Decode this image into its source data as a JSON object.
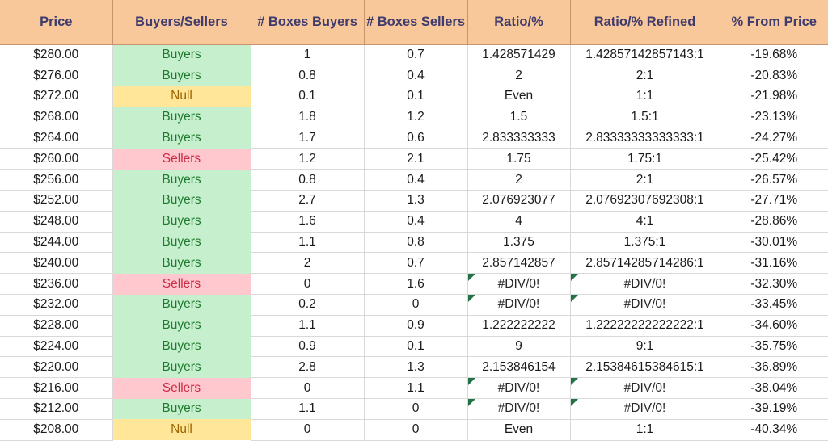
{
  "table": {
    "headers": [
      "Price",
      "Buyers/Sellers",
      "# Boxes Buyers",
      "# Boxes Sellers",
      "Ratio/%",
      "Ratio/% Refined",
      "% From Price"
    ],
    "colors": {
      "header_bg": "#F8C89B",
      "header_text": "#3F3B6D",
      "header_border": "#C8926A",
      "buyers_bg": "#C6EFCE",
      "buyers_text": "#1E7A2E",
      "sellers_bg": "#FFC7CE",
      "sellers_text": "#CC2B43",
      "null_bg": "#FFE699",
      "null_text": "#9C6500",
      "grid_line": "#D9D9D9",
      "error_flag": "#217346"
    },
    "rows": [
      {
        "price": "$280.00",
        "side": "Buyers",
        "side_state": "buyers",
        "boxes_buyers": "1",
        "boxes_sellers": "0.7",
        "ratio": "1.428571429",
        "ratio_error": false,
        "ratio_refined": "1.42857142857143:1",
        "ratio_refined_error": false,
        "pct_from_price": "-19.68%"
      },
      {
        "price": "$276.00",
        "side": "Buyers",
        "side_state": "buyers",
        "boxes_buyers": "0.8",
        "boxes_sellers": "0.4",
        "ratio": "2",
        "ratio_error": false,
        "ratio_refined": "2:1",
        "ratio_refined_error": false,
        "pct_from_price": "-20.83%"
      },
      {
        "price": "$272.00",
        "side": "Null",
        "side_state": "null",
        "boxes_buyers": "0.1",
        "boxes_sellers": "0.1",
        "ratio": "Even",
        "ratio_error": false,
        "ratio_refined": "1:1",
        "ratio_refined_error": false,
        "pct_from_price": "-21.98%"
      },
      {
        "price": "$268.00",
        "side": "Buyers",
        "side_state": "buyers",
        "boxes_buyers": "1.8",
        "boxes_sellers": "1.2",
        "ratio": "1.5",
        "ratio_error": false,
        "ratio_refined": "1.5:1",
        "ratio_refined_error": false,
        "pct_from_price": "-23.13%"
      },
      {
        "price": "$264.00",
        "side": "Buyers",
        "side_state": "buyers",
        "boxes_buyers": "1.7",
        "boxes_sellers": "0.6",
        "ratio": "2.833333333",
        "ratio_error": false,
        "ratio_refined": "2.83333333333333:1",
        "ratio_refined_error": false,
        "pct_from_price": "-24.27%"
      },
      {
        "price": "$260.00",
        "side": "Sellers",
        "side_state": "sellers",
        "boxes_buyers": "1.2",
        "boxes_sellers": "2.1",
        "ratio": "1.75",
        "ratio_error": false,
        "ratio_refined": "1.75:1",
        "ratio_refined_error": false,
        "pct_from_price": "-25.42%"
      },
      {
        "price": "$256.00",
        "side": "Buyers",
        "side_state": "buyers",
        "boxes_buyers": "0.8",
        "boxes_sellers": "0.4",
        "ratio": "2",
        "ratio_error": false,
        "ratio_refined": "2:1",
        "ratio_refined_error": false,
        "pct_from_price": "-26.57%"
      },
      {
        "price": "$252.00",
        "side": "Buyers",
        "side_state": "buyers",
        "boxes_buyers": "2.7",
        "boxes_sellers": "1.3",
        "ratio": "2.076923077",
        "ratio_error": false,
        "ratio_refined": "2.07692307692308:1",
        "ratio_refined_error": false,
        "pct_from_price": "-27.71%"
      },
      {
        "price": "$248.00",
        "side": "Buyers",
        "side_state": "buyers",
        "boxes_buyers": "1.6",
        "boxes_sellers": "0.4",
        "ratio": "4",
        "ratio_error": false,
        "ratio_refined": "4:1",
        "ratio_refined_error": false,
        "pct_from_price": "-28.86%"
      },
      {
        "price": "$244.00",
        "side": "Buyers",
        "side_state": "buyers",
        "boxes_buyers": "1.1",
        "boxes_sellers": "0.8",
        "ratio": "1.375",
        "ratio_error": false,
        "ratio_refined": "1.375:1",
        "ratio_refined_error": false,
        "pct_from_price": "-30.01%"
      },
      {
        "price": "$240.00",
        "side": "Buyers",
        "side_state": "buyers",
        "boxes_buyers": "2",
        "boxes_sellers": "0.7",
        "ratio": "2.857142857",
        "ratio_error": false,
        "ratio_refined": "2.85714285714286:1",
        "ratio_refined_error": false,
        "pct_from_price": "-31.16%"
      },
      {
        "price": "$236.00",
        "side": "Sellers",
        "side_state": "sellers",
        "boxes_buyers": "0",
        "boxes_sellers": "1.6",
        "ratio": "#DIV/0!",
        "ratio_error": true,
        "ratio_refined": "#DIV/0!",
        "ratio_refined_error": true,
        "pct_from_price": "-32.30%"
      },
      {
        "price": "$232.00",
        "side": "Buyers",
        "side_state": "buyers",
        "boxes_buyers": "0.2",
        "boxes_sellers": "0",
        "ratio": "#DIV/0!",
        "ratio_error": true,
        "ratio_refined": "#DIV/0!",
        "ratio_refined_error": true,
        "pct_from_price": "-33.45%"
      },
      {
        "price": "$228.00",
        "side": "Buyers",
        "side_state": "buyers",
        "boxes_buyers": "1.1",
        "boxes_sellers": "0.9",
        "ratio": "1.222222222",
        "ratio_error": false,
        "ratio_refined": "1.22222222222222:1",
        "ratio_refined_error": false,
        "pct_from_price": "-34.60%"
      },
      {
        "price": "$224.00",
        "side": "Buyers",
        "side_state": "buyers",
        "boxes_buyers": "0.9",
        "boxes_sellers": "0.1",
        "ratio": "9",
        "ratio_error": false,
        "ratio_refined": "9:1",
        "ratio_refined_error": false,
        "pct_from_price": "-35.75%"
      },
      {
        "price": "$220.00",
        "side": "Buyers",
        "side_state": "buyers",
        "boxes_buyers": "2.8",
        "boxes_sellers": "1.3",
        "ratio": "2.153846154",
        "ratio_error": false,
        "ratio_refined": "2.15384615384615:1",
        "ratio_refined_error": false,
        "pct_from_price": "-36.89%"
      },
      {
        "price": "$216.00",
        "side": "Sellers",
        "side_state": "sellers",
        "boxes_buyers": "0",
        "boxes_sellers": "1.1",
        "ratio": "#DIV/0!",
        "ratio_error": true,
        "ratio_refined": "#DIV/0!",
        "ratio_refined_error": true,
        "pct_from_price": "-38.04%"
      },
      {
        "price": "$212.00",
        "side": "Buyers",
        "side_state": "buyers",
        "boxes_buyers": "1.1",
        "boxes_sellers": "0",
        "ratio": "#DIV/0!",
        "ratio_error": true,
        "ratio_refined": "#DIV/0!",
        "ratio_refined_error": true,
        "pct_from_price": "-39.19%"
      },
      {
        "price": "$208.00",
        "side": "Null",
        "side_state": "null",
        "boxes_buyers": "0",
        "boxes_sellers": "0",
        "ratio": "Even",
        "ratio_error": false,
        "ratio_refined": "1:1",
        "ratio_refined_error": false,
        "pct_from_price": "-40.34%"
      }
    ]
  }
}
